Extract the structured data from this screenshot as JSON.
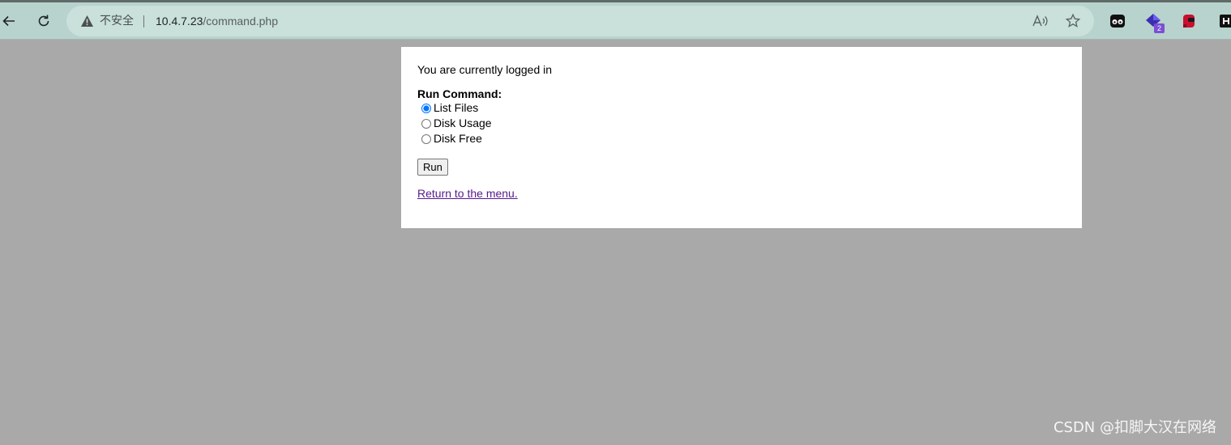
{
  "browser": {
    "security_label": "不安全",
    "url_host": "10.4.7.23",
    "url_path": "/command.php",
    "extension_badge": "2",
    "icons": [
      "back-arrow-icon",
      "reload-icon",
      "warning-triangle-icon",
      "read-aloud-icon",
      "star-icon",
      "extension-icons"
    ]
  },
  "page": {
    "status_text": "You are currently logged in",
    "run_label": "Run Command:",
    "options": [
      "List Files",
      "Disk Usage",
      "Disk Free"
    ],
    "selected_option": "List Files",
    "run_button": "Run",
    "return_link": "Return to the menu."
  },
  "watermark": "CSDN @扣脚大汉在网络",
  "colors": {
    "toolbar": "#b8d3cd",
    "page_background": "#a9a9a9",
    "link": "#551a8b"
  }
}
